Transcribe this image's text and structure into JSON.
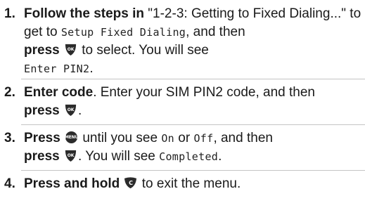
{
  "steps": [
    {
      "number": "1.",
      "lead_bold": "Follow the steps in",
      "quote": "\"1-2-3: Getting to Fixed Dialing...\"",
      "to_get_to": " to get to ",
      "lcd_target": "Setup Fixed Dialing",
      "comma_and_then": ", and then ",
      "press_bold": "press",
      "key_label": "OK",
      "key_icon": "ok-key-icon",
      "after_key": " to select. You will see ",
      "lcd_result": "Enter PIN2",
      "end": "."
    },
    {
      "number": "2.",
      "lead_bold": "Enter code",
      "middle": ". Enter your SIM PIN2 code, and then ",
      "press_bold": "press",
      "key_label": "OK",
      "key_icon": "ok-key-icon",
      "end": "."
    },
    {
      "number": "3.",
      "lead_bold": "Press",
      "key_label": "MENU",
      "key_icon": "menu-key-icon",
      "until_see": " until you see ",
      "lcd_on": "On",
      "or_word": " or ",
      "lcd_off": "Off",
      "comma_and_then": ", and then",
      "press_bold": "press",
      "key2_label": "OK",
      "key2_icon": "ok-key-icon",
      "see": ". You will see ",
      "lcd_result": "Completed",
      "end": "."
    },
    {
      "number": "4.",
      "lead_bold": "Press and hold",
      "key_label": "C",
      "key_icon": "clear-key-icon",
      "after_key": " to exit the menu."
    }
  ],
  "colors": {
    "key_fill": "#2b2b2b",
    "key_text": "#ffffff",
    "divider": "#c4c4c4"
  }
}
